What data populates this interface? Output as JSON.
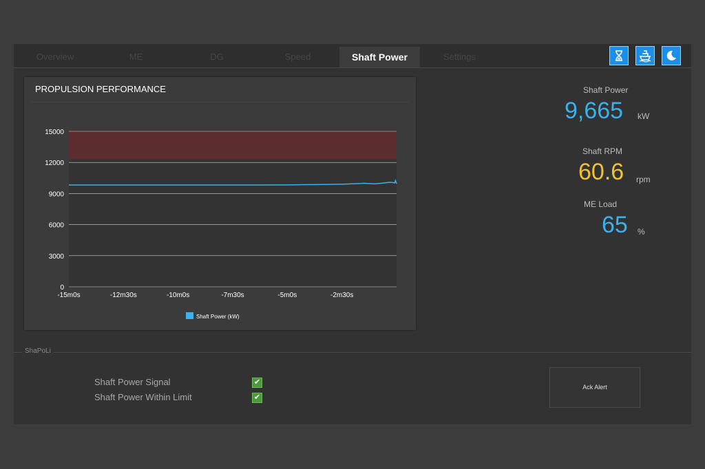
{
  "tabs": [
    {
      "label": "Overview",
      "active": false
    },
    {
      "label": "ME",
      "active": false
    },
    {
      "label": "DG",
      "active": false
    },
    {
      "label": "Speed",
      "active": false
    },
    {
      "label": "Shaft Power",
      "active": true
    },
    {
      "label": "Settings",
      "active": false
    }
  ],
  "toolbar_icons": [
    "hourglass-icon",
    "ship-icon",
    "moon-icon"
  ],
  "chart_panel": {
    "title": "PROPULSION PERFORMANCE"
  },
  "chart_data": {
    "type": "line",
    "title": "PROPULSION PERFORMANCE",
    "y_ticks": [
      "15000",
      "12000",
      "9000",
      "6000",
      "3000",
      "0"
    ],
    "x_ticks": [
      "-15m0s",
      "-12m30s",
      "-10m0s",
      "-7m30s",
      "-5m0s",
      "-2m30s"
    ],
    "ylim": [
      0,
      15000
    ],
    "xlim": [
      -900,
      0
    ],
    "grid": true,
    "alarm_band": {
      "from": 12300,
      "to": 15000,
      "color": "#5c2c2e"
    },
    "series": [
      {
        "name": "Shaft Power (kW)",
        "color": "#3ab0ec",
        "x": [
          -900,
          -800,
          -700,
          -600,
          -500,
          -400,
          -300,
          -250,
          -200,
          -150,
          -120,
          -100,
          -90,
          -80,
          -60,
          -40,
          -20,
          -10,
          -5,
          -3,
          0
        ],
        "y": [
          9820,
          9820,
          9820,
          9820,
          9820,
          9820,
          9830,
          9860,
          9870,
          9900,
          9940,
          9960,
          9990,
          9970,
          9930,
          10000,
          10080,
          10060,
          10020,
          10250,
          9950
        ]
      }
    ],
    "legend_position": "bottom"
  },
  "readouts": {
    "shaft_power": {
      "label": "Shaft Power",
      "value": "9,665",
      "unit": "kW",
      "color": "#3ab0ec"
    },
    "shaft_rpm": {
      "label": "Shaft RPM",
      "value": "60.6",
      "unit": "rpm",
      "color": "#f2c12e"
    },
    "me_load": {
      "label": "ME Load",
      "value": "65",
      "unit": "%",
      "color": "#3ab0ec"
    }
  },
  "shapoli": {
    "group_label": "ShaPoLi",
    "checks": [
      {
        "label": "Shaft Power Signal",
        "checked": true
      },
      {
        "label": "Shaft Power Within Limit",
        "checked": true
      }
    ],
    "ack_button": "Ack Alert"
  }
}
